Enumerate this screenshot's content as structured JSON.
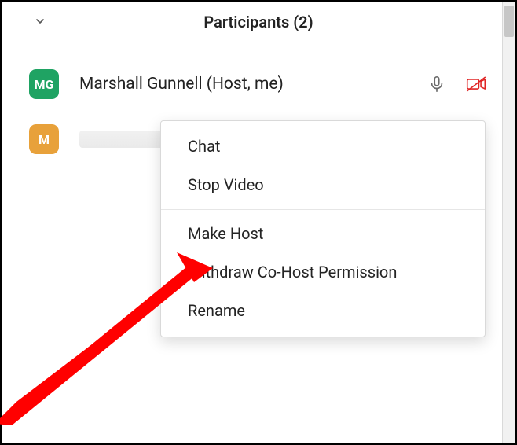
{
  "header": {
    "title": "Participants (2)"
  },
  "participants": [
    {
      "initials": "MG",
      "avatar_color": "green",
      "name": "Marshall Gunnell (Host, me)"
    },
    {
      "initials": "M",
      "avatar_color": "orange",
      "name_redacted": true
    }
  ],
  "context_menu": {
    "groups": [
      [
        "Chat",
        "Stop Video"
      ],
      [
        "Make Host",
        "Withdraw Co-Host Permission",
        "Rename"
      ]
    ]
  }
}
